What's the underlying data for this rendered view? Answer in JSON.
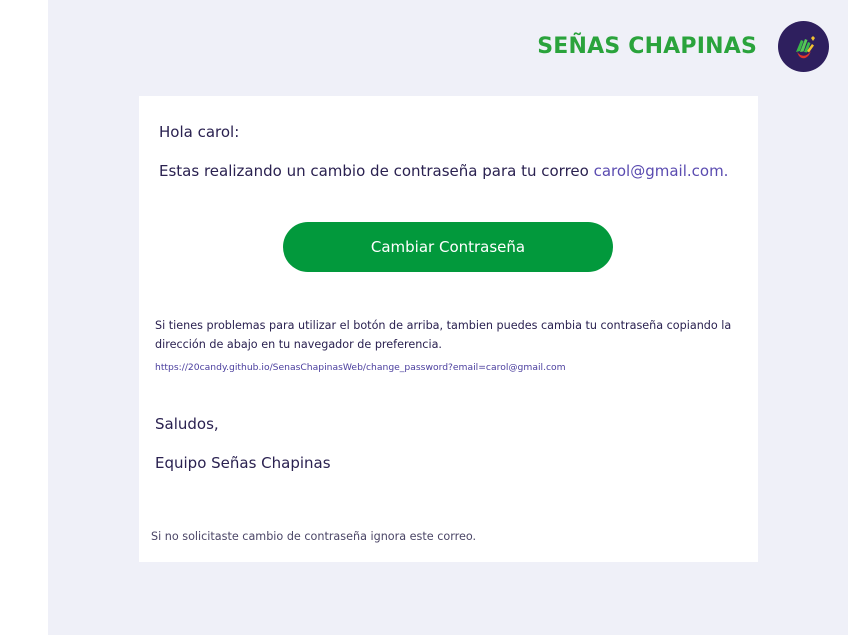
{
  "header": {
    "brand_name": "SEÑAS CHAPINAS",
    "logo_icon": "hand-sign-logo-icon"
  },
  "email": {
    "greeting": "Hola carol:",
    "intro_text": "Estas realizando un cambio de contraseña para tu correo ",
    "recipient_email": "carol@gmail.com.",
    "button_label": "Cambiar Contraseña",
    "help_text": "Si tienes problemas para utilizar el botón de arriba, tambien puedes cambia tu contraseña copiando la dirección de abajo en tu navegador de preferencia.",
    "help_link": "https://20candy.github.io/SenasChapinasWeb/change_password?email=carol@gmail.com",
    "closing": "Saludos,",
    "signature": "Equipo Señas Chapinas",
    "footnote": "Si no solicitaste cambio de contraseña ignora este correo."
  },
  "colors": {
    "brand_green": "#2aa33c",
    "button_green": "#02993c",
    "logo_bg": "#2e1f5e",
    "text_dark": "#2a2150",
    "link_purple": "#5a4bb0",
    "panel_bg": "#eff0f8"
  }
}
